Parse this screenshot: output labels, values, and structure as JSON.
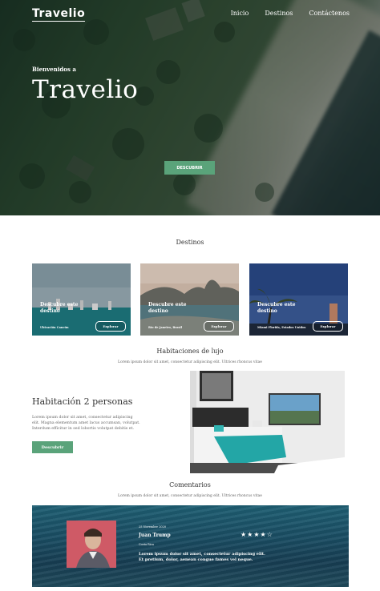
{
  "header": {
    "logo": "Travelio",
    "nav": [
      "Inicio",
      "Destinos",
      "Contáctenos"
    ]
  },
  "hero": {
    "welcome": "Bienvenidos a",
    "title": "Travelio",
    "button": "DESCUBRIR"
  },
  "destinos": {
    "title": "Destinos",
    "cards": [
      {
        "title": "Descubre este destino",
        "address": "Ubicación Cancún",
        "button": "Explorar"
      },
      {
        "title": "Descubre este destino",
        "address": "Río de Janeiro, Brasil",
        "button": "Explorar"
      },
      {
        "title": "Descubre este destino",
        "address": "Miami Florida, Estados Unidos",
        "button": "Explorar"
      }
    ]
  },
  "lujo": {
    "title": "Habitaciones de lujo",
    "subtitle": "Lorem ipsum dolor sit amet, consectetur adipiscing elit. Ultrices rhoncus vitae",
    "room_title": "Habitación 2 personas",
    "room_text": "Lorem ipsum dolor sit amet, consectetur adipiscing elit. Magna elementum amet lacus accumsan, volutpat. Interdum efficitur in sed lobortis volutpat debitis et.",
    "room_button": "Descubrir"
  },
  "comentarios": {
    "title": "Comentarios",
    "subtitle": "Lorem ipsum dolor sit amet, consectetur adipiscing elit. Ultrices rhoncus vitae",
    "review": {
      "date": "25 November 2020",
      "name": "Juan Trump",
      "location": "Costa Rica",
      "stars": "★★★★☆",
      "rating": 4,
      "text": "Lorem ipsum dolor sit amet, consectetur adipiscing elit. Et pretium, dolor, aenean congue fames vel neque."
    }
  },
  "colors": {
    "accent": "#5aa37a"
  }
}
